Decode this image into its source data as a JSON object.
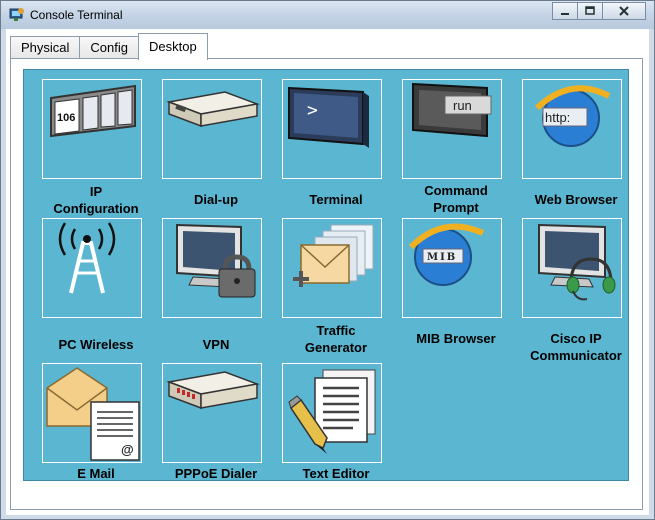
{
  "window": {
    "title": "Console Terminal"
  },
  "tabs": [
    {
      "label": "Physical",
      "active": false
    },
    {
      "label": "Config",
      "active": false
    },
    {
      "label": "Desktop",
      "active": true
    }
  ],
  "apps": [
    {
      "label_lines": [
        "IP",
        "Configuration"
      ],
      "icon": "ip-configuration-icon",
      "icon_text": "106"
    },
    {
      "label_lines": [
        "Dial-up"
      ],
      "icon": "dialup-modem-icon"
    },
    {
      "label_lines": [
        "Terminal"
      ],
      "icon": "terminal-icon",
      "icon_text": ">"
    },
    {
      "label_lines": [
        "Command",
        "Prompt"
      ],
      "icon": "command-prompt-icon",
      "icon_text": "run"
    },
    {
      "label_lines": [
        "Web Browser"
      ],
      "icon": "web-browser-icon",
      "icon_text": "http:"
    },
    {
      "label_lines": [
        "PC Wireless"
      ],
      "icon": "wireless-tower-icon"
    },
    {
      "label_lines": [
        "VPN"
      ],
      "icon": "vpn-lock-icon"
    },
    {
      "label_lines": [
        "Traffic",
        "Generator"
      ],
      "icon": "traffic-generator-icon"
    },
    {
      "label_lines": [
        "MIB Browser"
      ],
      "icon": "mib-browser-icon",
      "icon_text": "MIB"
    },
    {
      "label_lines": [
        "Cisco IP",
        "Communicator"
      ],
      "icon": "ip-communicator-icon"
    },
    {
      "label_lines": [
        "E Mail"
      ],
      "icon": "email-icon",
      "icon_text": "@"
    },
    {
      "label_lines": [
        "PPPoE Dialer"
      ],
      "icon": "pppoe-dialer-icon"
    },
    {
      "label_lines": [
        "Text Editor"
      ],
      "icon": "text-editor-icon"
    }
  ],
  "colors": {
    "desktop_bg": "#5bb6d1",
    "titlebar": "#c6d5e6"
  }
}
